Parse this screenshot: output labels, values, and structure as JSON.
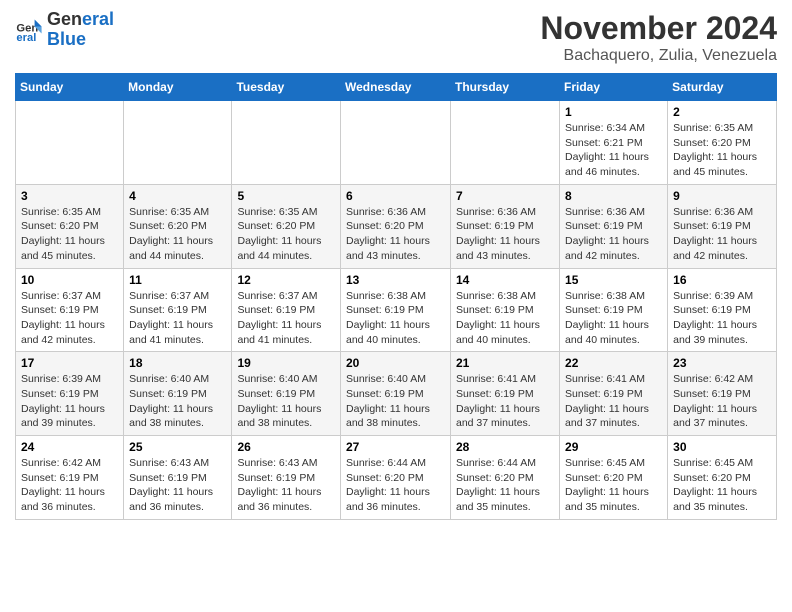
{
  "logo": {
    "line1": "General",
    "line2": "Blue"
  },
  "title": "November 2024",
  "subtitle": "Bachaquero, Zulia, Venezuela",
  "days_of_week": [
    "Sunday",
    "Monday",
    "Tuesday",
    "Wednesday",
    "Thursday",
    "Friday",
    "Saturday"
  ],
  "weeks": [
    [
      {
        "day": "",
        "info": ""
      },
      {
        "day": "",
        "info": ""
      },
      {
        "day": "",
        "info": ""
      },
      {
        "day": "",
        "info": ""
      },
      {
        "day": "",
        "info": ""
      },
      {
        "day": "1",
        "info": "Sunrise: 6:34 AM\nSunset: 6:21 PM\nDaylight: 11 hours\nand 46 minutes."
      },
      {
        "day": "2",
        "info": "Sunrise: 6:35 AM\nSunset: 6:20 PM\nDaylight: 11 hours\nand 45 minutes."
      }
    ],
    [
      {
        "day": "3",
        "info": "Sunrise: 6:35 AM\nSunset: 6:20 PM\nDaylight: 11 hours\nand 45 minutes."
      },
      {
        "day": "4",
        "info": "Sunrise: 6:35 AM\nSunset: 6:20 PM\nDaylight: 11 hours\nand 44 minutes."
      },
      {
        "day": "5",
        "info": "Sunrise: 6:35 AM\nSunset: 6:20 PM\nDaylight: 11 hours\nand 44 minutes."
      },
      {
        "day": "6",
        "info": "Sunrise: 6:36 AM\nSunset: 6:20 PM\nDaylight: 11 hours\nand 43 minutes."
      },
      {
        "day": "7",
        "info": "Sunrise: 6:36 AM\nSunset: 6:19 PM\nDaylight: 11 hours\nand 43 minutes."
      },
      {
        "day": "8",
        "info": "Sunrise: 6:36 AM\nSunset: 6:19 PM\nDaylight: 11 hours\nand 42 minutes."
      },
      {
        "day": "9",
        "info": "Sunrise: 6:36 AM\nSunset: 6:19 PM\nDaylight: 11 hours\nand 42 minutes."
      }
    ],
    [
      {
        "day": "10",
        "info": "Sunrise: 6:37 AM\nSunset: 6:19 PM\nDaylight: 11 hours\nand 42 minutes."
      },
      {
        "day": "11",
        "info": "Sunrise: 6:37 AM\nSunset: 6:19 PM\nDaylight: 11 hours\nand 41 minutes."
      },
      {
        "day": "12",
        "info": "Sunrise: 6:37 AM\nSunset: 6:19 PM\nDaylight: 11 hours\nand 41 minutes."
      },
      {
        "day": "13",
        "info": "Sunrise: 6:38 AM\nSunset: 6:19 PM\nDaylight: 11 hours\nand 40 minutes."
      },
      {
        "day": "14",
        "info": "Sunrise: 6:38 AM\nSunset: 6:19 PM\nDaylight: 11 hours\nand 40 minutes."
      },
      {
        "day": "15",
        "info": "Sunrise: 6:38 AM\nSunset: 6:19 PM\nDaylight: 11 hours\nand 40 minutes."
      },
      {
        "day": "16",
        "info": "Sunrise: 6:39 AM\nSunset: 6:19 PM\nDaylight: 11 hours\nand 39 minutes."
      }
    ],
    [
      {
        "day": "17",
        "info": "Sunrise: 6:39 AM\nSunset: 6:19 PM\nDaylight: 11 hours\nand 39 minutes."
      },
      {
        "day": "18",
        "info": "Sunrise: 6:40 AM\nSunset: 6:19 PM\nDaylight: 11 hours\nand 38 minutes."
      },
      {
        "day": "19",
        "info": "Sunrise: 6:40 AM\nSunset: 6:19 PM\nDaylight: 11 hours\nand 38 minutes."
      },
      {
        "day": "20",
        "info": "Sunrise: 6:40 AM\nSunset: 6:19 PM\nDaylight: 11 hours\nand 38 minutes."
      },
      {
        "day": "21",
        "info": "Sunrise: 6:41 AM\nSunset: 6:19 PM\nDaylight: 11 hours\nand 37 minutes."
      },
      {
        "day": "22",
        "info": "Sunrise: 6:41 AM\nSunset: 6:19 PM\nDaylight: 11 hours\nand 37 minutes."
      },
      {
        "day": "23",
        "info": "Sunrise: 6:42 AM\nSunset: 6:19 PM\nDaylight: 11 hours\nand 37 minutes."
      }
    ],
    [
      {
        "day": "24",
        "info": "Sunrise: 6:42 AM\nSunset: 6:19 PM\nDaylight: 11 hours\nand 36 minutes."
      },
      {
        "day": "25",
        "info": "Sunrise: 6:43 AM\nSunset: 6:19 PM\nDaylight: 11 hours\nand 36 minutes."
      },
      {
        "day": "26",
        "info": "Sunrise: 6:43 AM\nSunset: 6:19 PM\nDaylight: 11 hours\nand 36 minutes."
      },
      {
        "day": "27",
        "info": "Sunrise: 6:44 AM\nSunset: 6:20 PM\nDaylight: 11 hours\nand 36 minutes."
      },
      {
        "day": "28",
        "info": "Sunrise: 6:44 AM\nSunset: 6:20 PM\nDaylight: 11 hours\nand 35 minutes."
      },
      {
        "day": "29",
        "info": "Sunrise: 6:45 AM\nSunset: 6:20 PM\nDaylight: 11 hours\nand 35 minutes."
      },
      {
        "day": "30",
        "info": "Sunrise: 6:45 AM\nSunset: 6:20 PM\nDaylight: 11 hours\nand 35 minutes."
      }
    ]
  ]
}
